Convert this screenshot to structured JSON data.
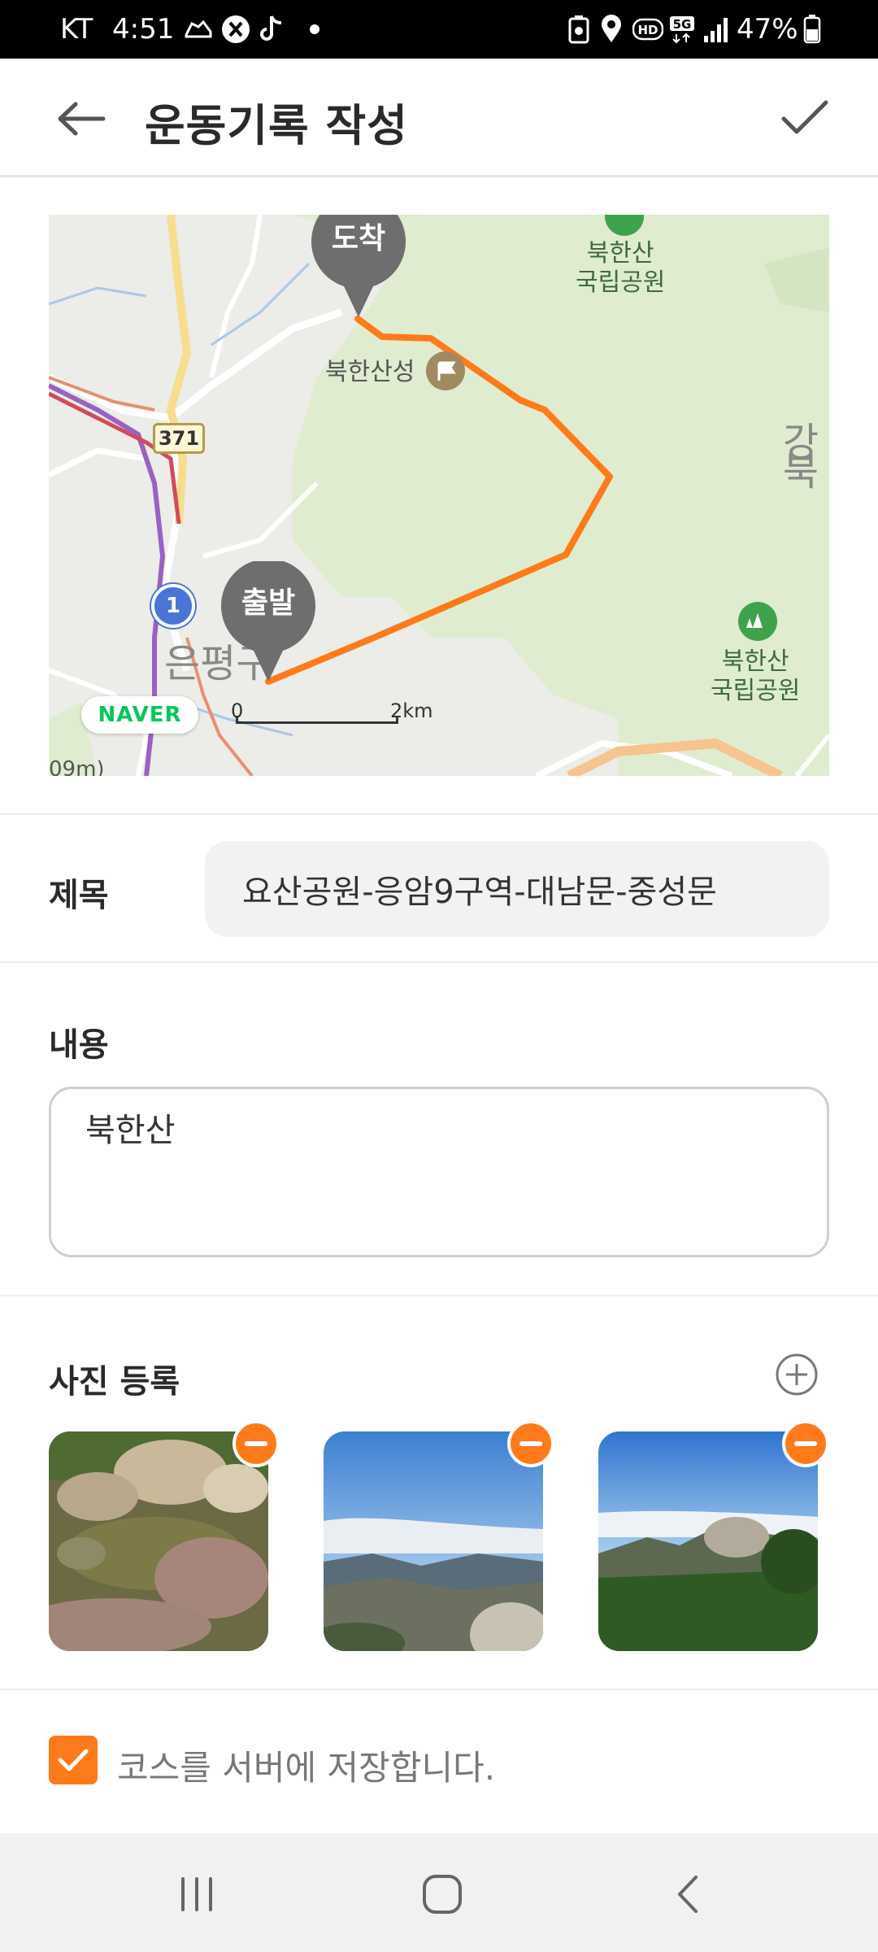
{
  "status_bar": {
    "carrier": "KT",
    "time": "4:51",
    "battery_percent": "47%",
    "network": "5G",
    "hd": "HD"
  },
  "header": {
    "title": "운동기록 작성"
  },
  "map": {
    "arrival_marker": "도착",
    "departure_marker": "출발",
    "place_fortress": "북한산성",
    "park_label_top": "북한산\n국립공원",
    "park_label_bottom": "북한산\n국립공원",
    "district_label": "은평구",
    "district_label_right": "강북",
    "road_number": "371",
    "route_number": "1",
    "naver_logo": "NAVER",
    "scale_start": "0",
    "scale_end": "2km",
    "edge_label": "09m)"
  },
  "form": {
    "title_label": "제목",
    "title_value": "요산공원-응암9구역-대남문-중성문",
    "content_label": "내용",
    "content_value": "북한산",
    "photo_label": "사진 등록",
    "save_course_label": "코스를 서버에 저장합니다.",
    "save_course_checked": true
  },
  "colors": {
    "accent": "#ff7a1a",
    "route": "#ff7a1a",
    "park": "#dfeccf"
  }
}
